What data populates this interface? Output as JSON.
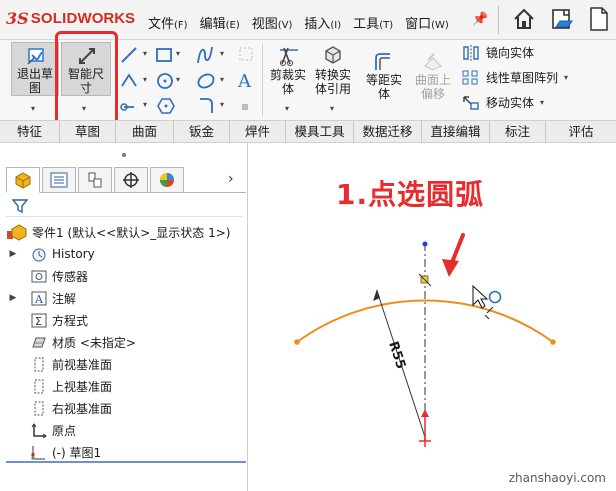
{
  "app": {
    "brand_ds": "3S",
    "brand_solid": "SOLID",
    "brand_works": "WORKS",
    "menus": [
      {
        "label": "文件",
        "key": "(F)"
      },
      {
        "label": "编辑",
        "key": "(E)"
      },
      {
        "label": "视图",
        "key": "(V)"
      },
      {
        "label": "插入",
        "key": "(I)"
      },
      {
        "label": "工具",
        "key": "(T)"
      },
      {
        "label": "窗口",
        "key": "(W)"
      }
    ]
  },
  "ribbon": {
    "exit_sketch": "退出草图",
    "smart_dimension": "智能尺寸",
    "trim": "剪裁实体",
    "convert": "转换实体引用",
    "offset": "等距实体",
    "offset_surface": "曲面上偏移",
    "mirror": "镜向实体",
    "linear_pattern": "线性草图阵列",
    "move": "移动实体"
  },
  "tabs": [
    "特征",
    "草图",
    "曲面",
    "钣金",
    "焊件",
    "模具工具",
    "数据迁移",
    "直接编辑",
    "标注",
    "评估"
  ],
  "tree": {
    "part": "零件1 (默认<<默认>_显示状态 1>)",
    "items": [
      "History",
      "传感器",
      "注解",
      "方程式",
      "材质 <未指定>",
      "前视基准面",
      "上视基准面",
      "右视基准面",
      "原点",
      "(-) 草图1"
    ]
  },
  "canvas": {
    "annotation": "1.点选圆弧",
    "dimension": "R55",
    "watermark": "zhanshaoyi.com"
  },
  "colors": {
    "brand": "#d52b1e",
    "arc": "#f08c1e",
    "highlight": "#e82b2b"
  }
}
